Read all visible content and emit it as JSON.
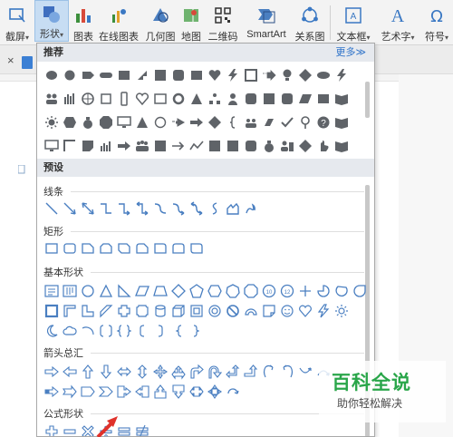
{
  "ribbon": {
    "items": [
      {
        "label": "截屏",
        "caret": "▾"
      },
      {
        "label": "形状",
        "caret": "▾"
      },
      {
        "label": "图表"
      },
      {
        "label": "在线图表"
      },
      {
        "label": "几何图"
      },
      {
        "label": "地图"
      },
      {
        "label": "二维码"
      },
      {
        "label": "SmartArt"
      },
      {
        "label": "关系图"
      },
      {
        "label": "文本框",
        "caret": "▾"
      },
      {
        "label": "艺术字",
        "caret": "▾"
      },
      {
        "label": "符号",
        "caret": "▾"
      }
    ],
    "accent": "#2f73c9",
    "active_bg": "#c7ddf3"
  },
  "tabbar": {
    "close_glyph": "×"
  },
  "panel": {
    "recommended": {
      "title": "推荐",
      "more": "更多≫"
    },
    "presets": {
      "title": "预设"
    },
    "categories": {
      "lines": "线条",
      "rects": "矩形",
      "basic": "基本形状",
      "arrows": "箭头总汇",
      "formula": "公式形状"
    },
    "shape_fill": "#5f6368",
    "outline_color": "#4a7fc1"
  },
  "watermark": {
    "title": "百科全说",
    "subtitle": "助你轻松解决",
    "color": "#2aa64a"
  }
}
